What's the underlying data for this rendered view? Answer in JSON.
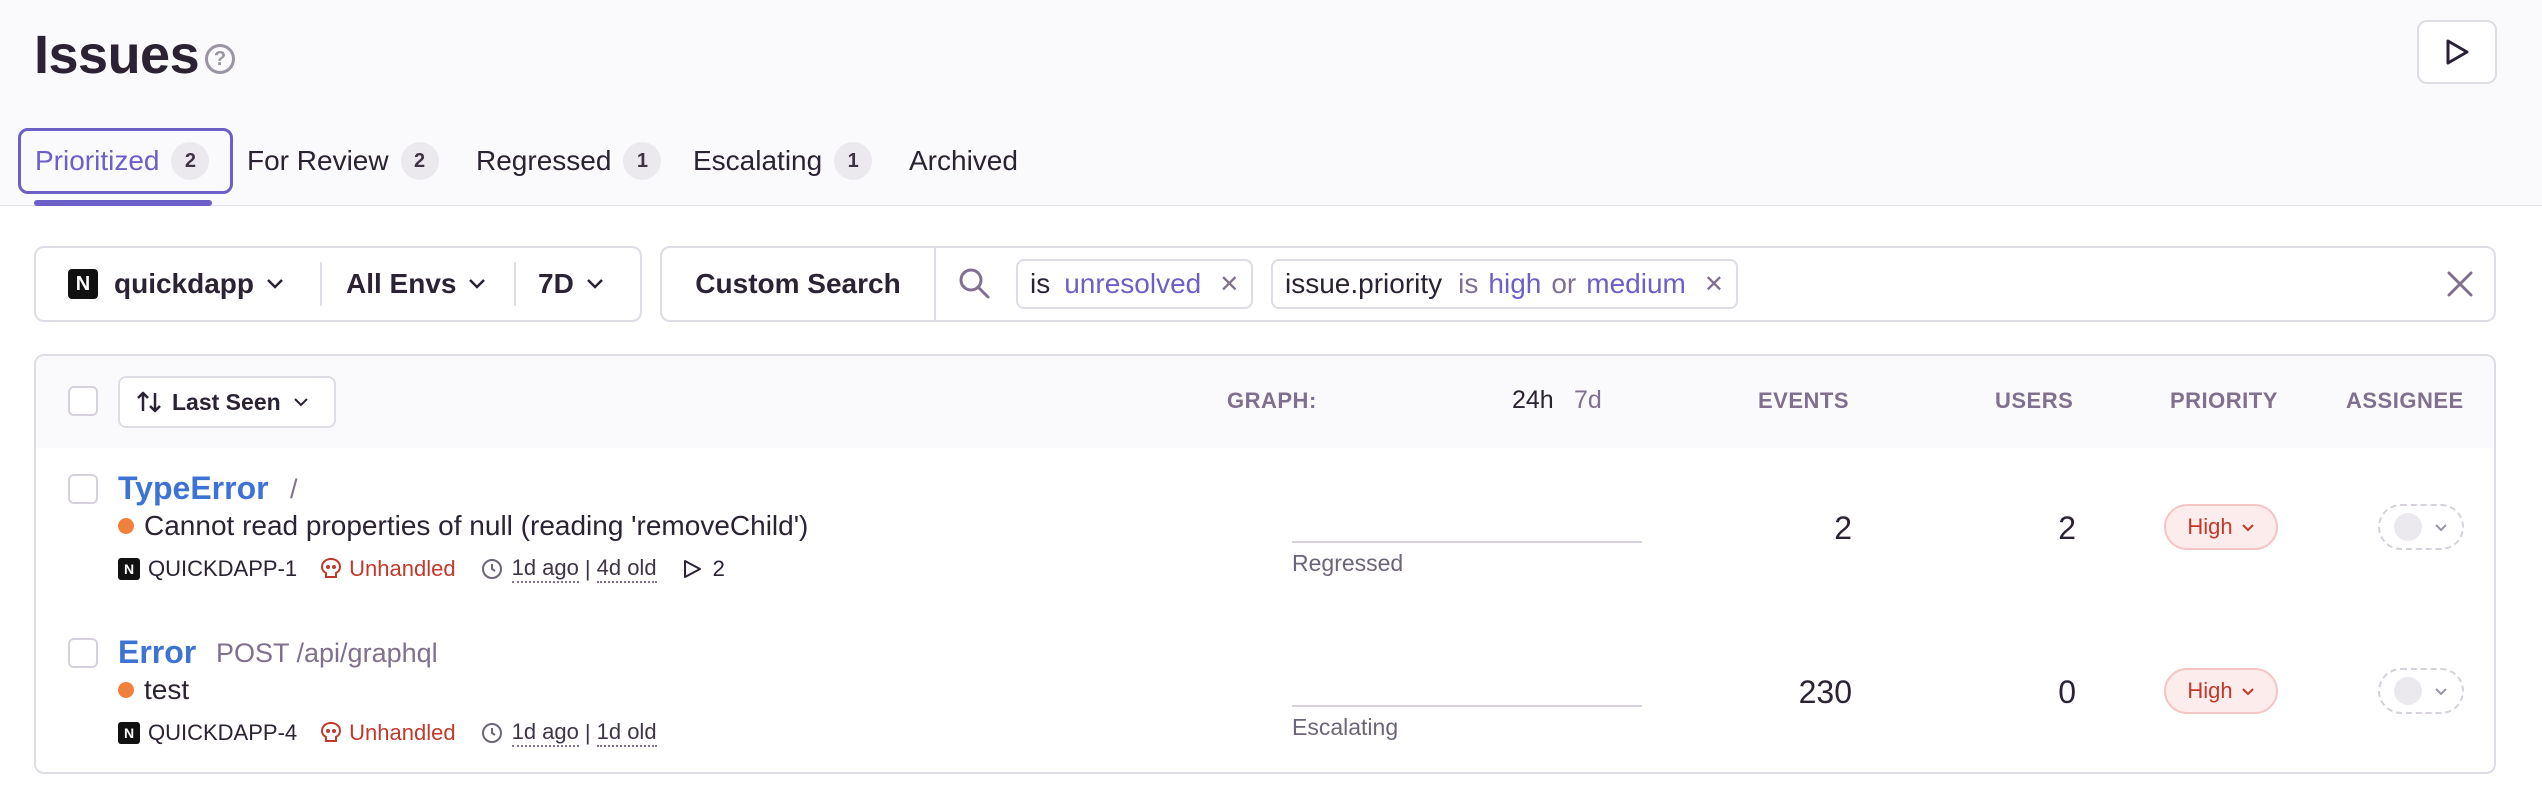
{
  "page": {
    "title": "Issues"
  },
  "tabs": [
    {
      "label": "Prioritized",
      "count": "2"
    },
    {
      "label": "For Review",
      "count": "2"
    },
    {
      "label": "Regressed",
      "count": "1"
    },
    {
      "label": "Escalating",
      "count": "1"
    },
    {
      "label": "Archived"
    }
  ],
  "filters": {
    "project": "quickdapp",
    "project_icon": "N",
    "environment": "All Envs",
    "period": "7D"
  },
  "search": {
    "custom_search_label": "Custom Search",
    "tokens": [
      {
        "key": "is",
        "value": "unresolved"
      },
      {
        "key": "issue.priority",
        "op": "is",
        "value1": "high",
        "joiner": "or",
        "value2": "medium"
      }
    ]
  },
  "table": {
    "sort_label": "Last Seen",
    "headers": {
      "graph": "GRAPH:",
      "period_24h": "24h",
      "period_7d": "7d",
      "events": "EVENTS",
      "users": "USERS",
      "priority": "PRIORITY",
      "assignee": "ASSIGNEE"
    },
    "rows": [
      {
        "type": "TypeError",
        "location": "/",
        "message": "Cannot read properties of null (reading 'removeChild')",
        "short_id": "QUICKDAPP-1",
        "handled": "Unhandled",
        "last_seen": "1d ago",
        "age": "4d old",
        "replays": "2",
        "graph_label": "Regressed",
        "events": "2",
        "users": "2",
        "priority": "High"
      },
      {
        "type": "Error",
        "location": "POST /api/graphql",
        "message": "test",
        "short_id": "QUICKDAPP-4",
        "handled": "Unhandled",
        "last_seen": "1d ago",
        "age": "1d old",
        "graph_label": "Escalating",
        "events": "230",
        "users": "0",
        "priority": "High"
      }
    ]
  },
  "colors": {
    "accent": "#6c5fc7",
    "link": "#3e73d6",
    "error": "#c0392b",
    "warning_dot": "#f2803d"
  }
}
